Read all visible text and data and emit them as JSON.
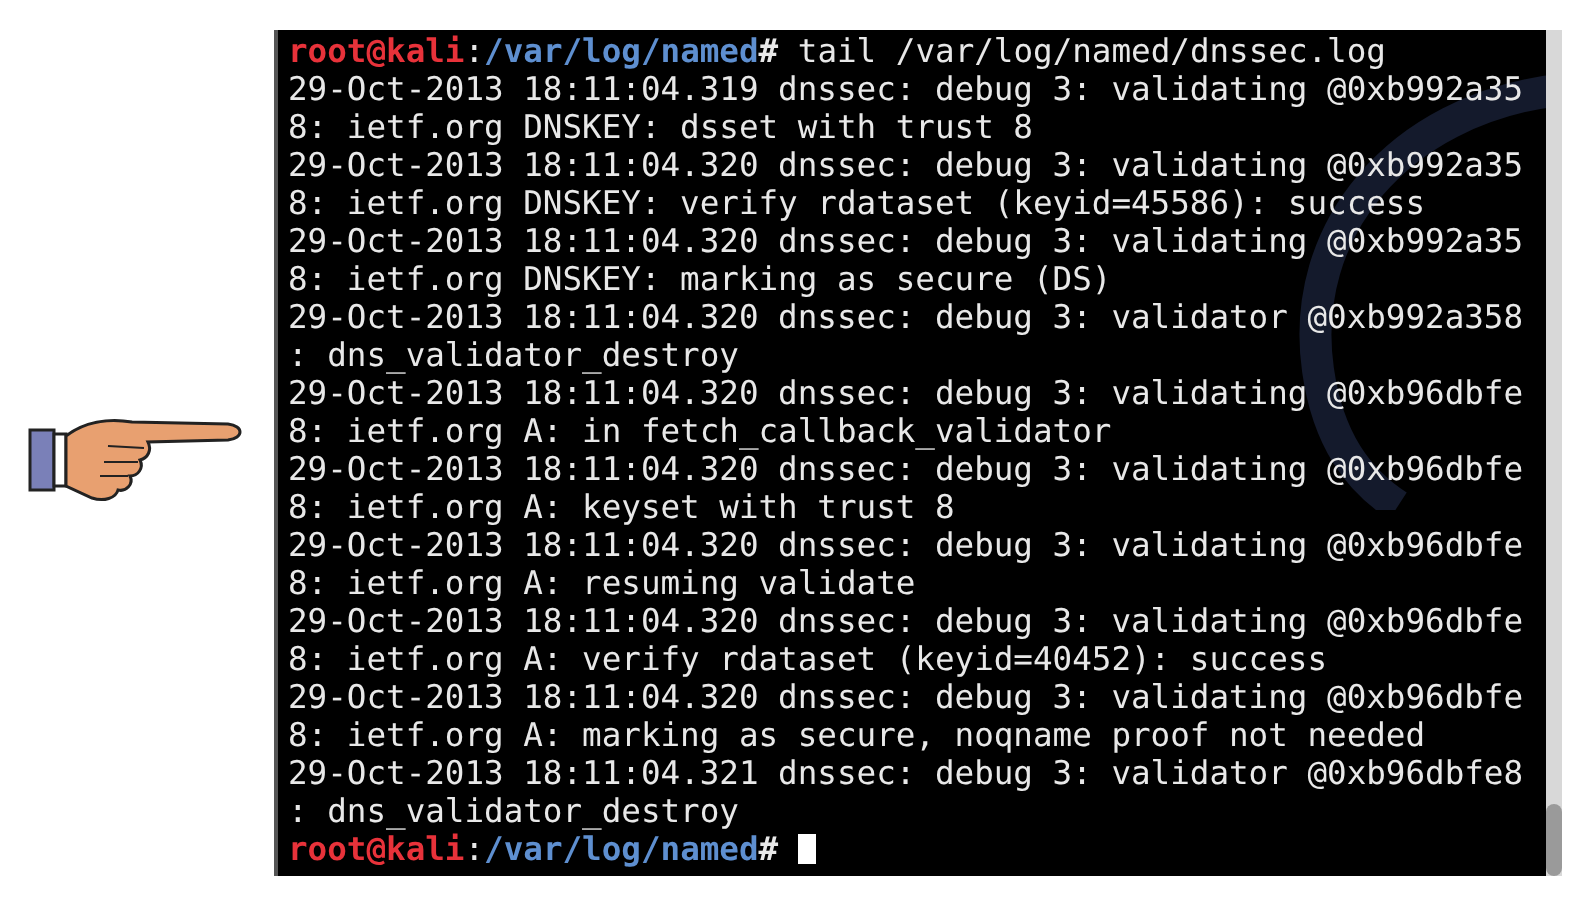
{
  "terminal": {
    "lines": [
      {
        "kind": "prompt",
        "user": "root@kali",
        "separator": ":",
        "path": "/var/log/named",
        "symbol": "#",
        "command": " tail /var/log/named/dnssec.log",
        "cursor": false
      },
      {
        "kind": "output",
        "text": "29-Oct-2013 18:11:04.319 dnssec: debug 3: validating @0xb992a35"
      },
      {
        "kind": "output",
        "text": "8: ietf.org DNSKEY: dsset with trust 8"
      },
      {
        "kind": "output",
        "text": "29-Oct-2013 18:11:04.320 dnssec: debug 3: validating @0xb992a35"
      },
      {
        "kind": "output",
        "text": "8: ietf.org DNSKEY: verify rdataset (keyid=45586): success"
      },
      {
        "kind": "output",
        "text": "29-Oct-2013 18:11:04.320 dnssec: debug 3: validating @0xb992a35"
      },
      {
        "kind": "output",
        "text": "8: ietf.org DNSKEY: marking as secure (DS)"
      },
      {
        "kind": "output",
        "text": "29-Oct-2013 18:11:04.320 dnssec: debug 3: validator @0xb992a358"
      },
      {
        "kind": "output",
        "text": ": dns_validator_destroy"
      },
      {
        "kind": "output",
        "text": "29-Oct-2013 18:11:04.320 dnssec: debug 3: validating @0xb96dbfe"
      },
      {
        "kind": "output",
        "text": "8: ietf.org A: in fetch_callback_validator"
      },
      {
        "kind": "output",
        "text": "29-Oct-2013 18:11:04.320 dnssec: debug 3: validating @0xb96dbfe"
      },
      {
        "kind": "output",
        "text": "8: ietf.org A: keyset with trust 8"
      },
      {
        "kind": "output",
        "text": "29-Oct-2013 18:11:04.320 dnssec: debug 3: validating @0xb96dbfe"
      },
      {
        "kind": "output",
        "text": "8: ietf.org A: resuming validate"
      },
      {
        "kind": "output",
        "text": "29-Oct-2013 18:11:04.320 dnssec: debug 3: validating @0xb96dbfe"
      },
      {
        "kind": "output",
        "text": "8: ietf.org A: verify rdataset (keyid=40452): success"
      },
      {
        "kind": "output",
        "text": "29-Oct-2013 18:11:04.320 dnssec: debug 3: validating @0xb96dbfe"
      },
      {
        "kind": "output",
        "text": "8: ietf.org A: marking as secure, noqname proof not needed"
      },
      {
        "kind": "output",
        "text": "29-Oct-2013 18:11:04.321 dnssec: debug 3: validator @0xb96dbfe8"
      },
      {
        "kind": "output",
        "text": ": dns_validator_destroy"
      },
      {
        "kind": "prompt",
        "user": "root@kali",
        "separator": ":",
        "path": "/var/log/named",
        "symbol": "#",
        "cursor": true
      }
    ]
  }
}
